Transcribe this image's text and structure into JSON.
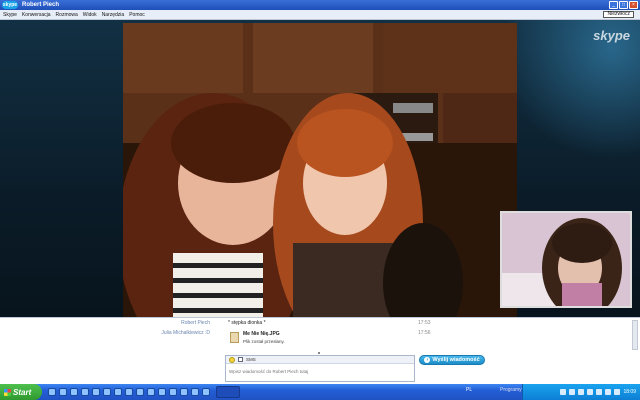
{
  "window": {
    "app_logo": "skype",
    "title": "Robert Piech"
  },
  "menu": {
    "items": [
      "Skype",
      "Konwersacja",
      "Rozmowa",
      "Widok",
      "Narzędzia",
      "Pomoc"
    ],
    "right_button": "Niezwłocz"
  },
  "video": {
    "watermark": "skype"
  },
  "chat": {
    "messages": [
      {
        "sender": "Robert Piech",
        "text": "* stępka dionka *",
        "time": "17:53"
      },
      {
        "sender": "Julia Michalkiewicz :D",
        "text": "",
        "time": "17:56"
      }
    ],
    "file": {
      "name": "Me Nie Nię.JPG",
      "status": "Plik został przesłany."
    },
    "input": {
      "sms_label": "SMS",
      "placeholder": "Wpisz wiadomość do Robert Piech tutaj"
    },
    "send_button": "Wyślij wiadomość"
  },
  "taskbar": {
    "start_label": "Start",
    "language": "PL",
    "programs": "Programy",
    "clock": "18:09"
  }
}
